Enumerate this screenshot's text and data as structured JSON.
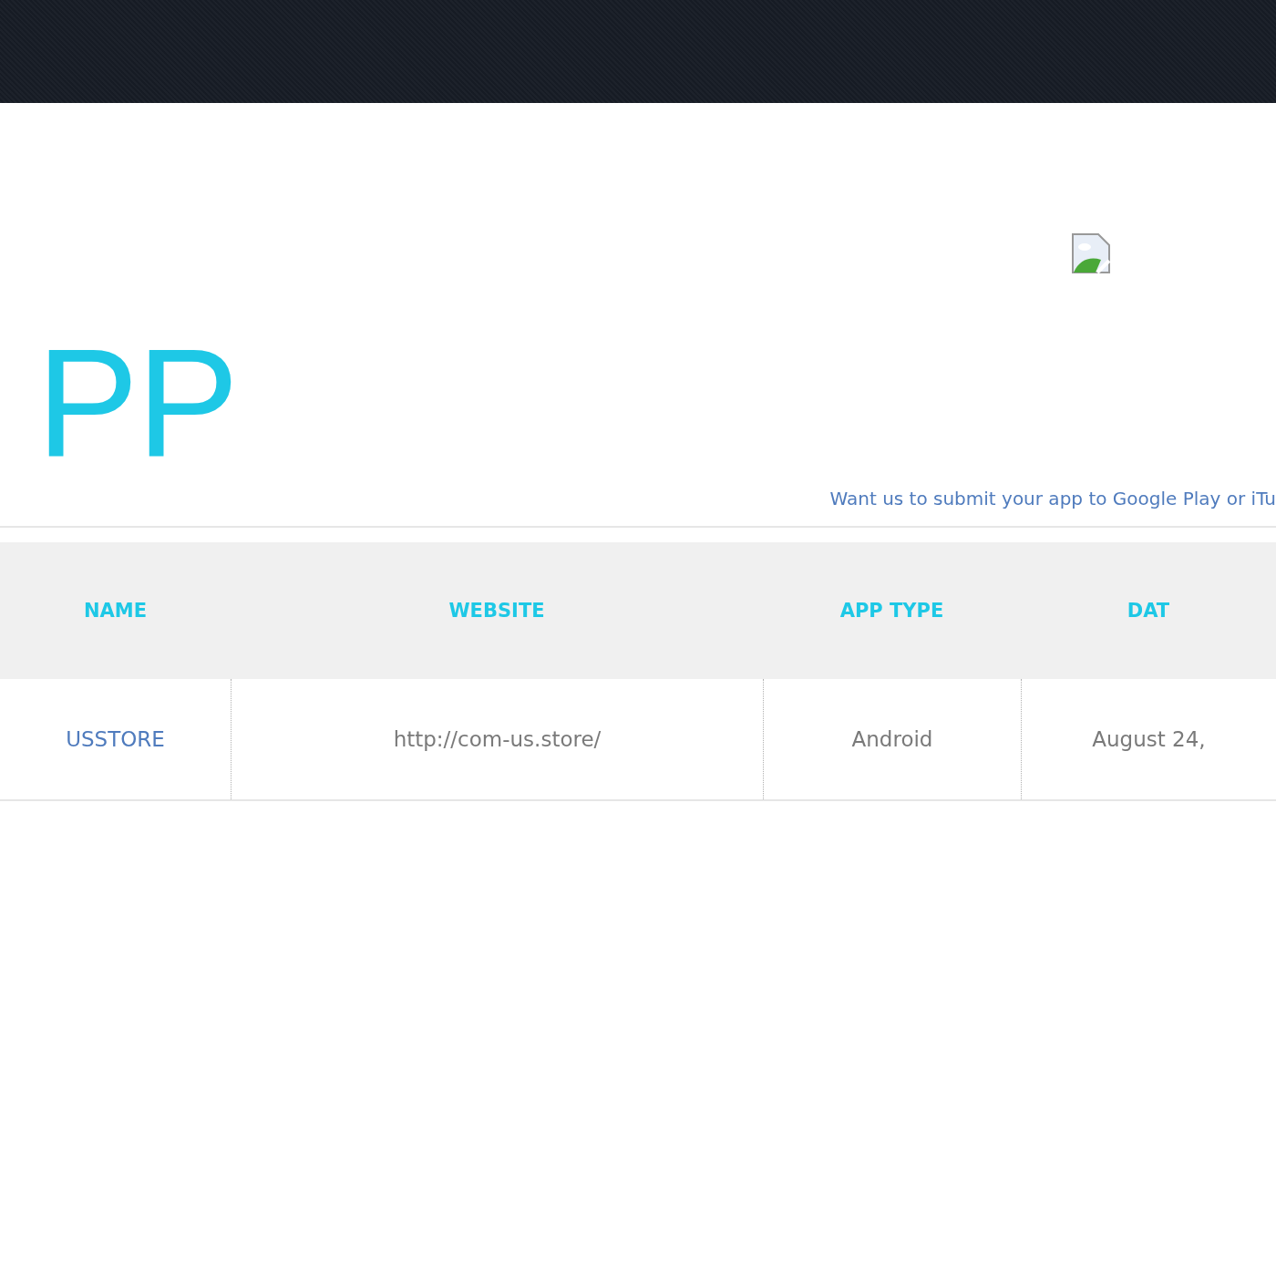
{
  "page": {
    "title": "PP",
    "note": "Want us to submit your app to Google Play or iTu"
  },
  "table": {
    "columns": [
      "NAME",
      "WEBSITE",
      "APP TYPE",
      "DAT"
    ],
    "rows": [
      {
        "cells": [
          "USSTORE",
          "http://com-us.store/",
          "Android",
          "August 24,"
        ]
      }
    ]
  }
}
